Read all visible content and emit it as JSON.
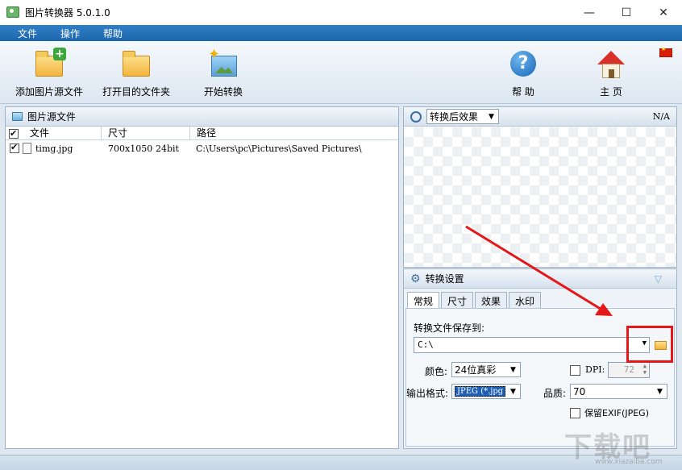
{
  "window": {
    "title": "图片转换器 5.0.1.0",
    "minimize": "—",
    "maximize": "☐",
    "close": "✕"
  },
  "menu": {
    "items": [
      "文件",
      "操作",
      "帮助"
    ]
  },
  "toolbar": {
    "add_source": "添加图片源文件",
    "open_target": "打开目的文件夹",
    "start": "开始转换",
    "help": "帮 助",
    "home": "主 页"
  },
  "source_panel": {
    "title": "图片源文件",
    "columns": [
      "文件",
      "尺寸",
      "路径"
    ],
    "rows": [
      {
        "name": "timg.jpg",
        "size": "700x1050",
        "depth": "24bit",
        "path": "C:\\Users\\pc\\Pictures\\Saved Pictures\\"
      }
    ]
  },
  "preview_panel": {
    "mode": "转换后效果",
    "status": "N/A"
  },
  "settings_panel": {
    "title": "转换设置",
    "tabs": [
      "常规",
      "尺寸",
      "效果",
      "水印"
    ],
    "save_label": "转换文件保存到:",
    "save_path": "C:\\",
    "color_label": "颜色:",
    "color_value": "24位真彩",
    "dpi_label": "DPI:",
    "dpi_value": "72",
    "format_label": "输出格式:",
    "format_value": "JPEG (*.jpg",
    "quality_label": "品质:",
    "quality_value": "70",
    "exif_label": "保留EXIF(JPEG)"
  },
  "watermark": {
    "text": "下载吧",
    "sub": "www.xiazaiba.com"
  },
  "colors": {
    "menubar": "#1d66ad",
    "annotation": "#e41818"
  }
}
